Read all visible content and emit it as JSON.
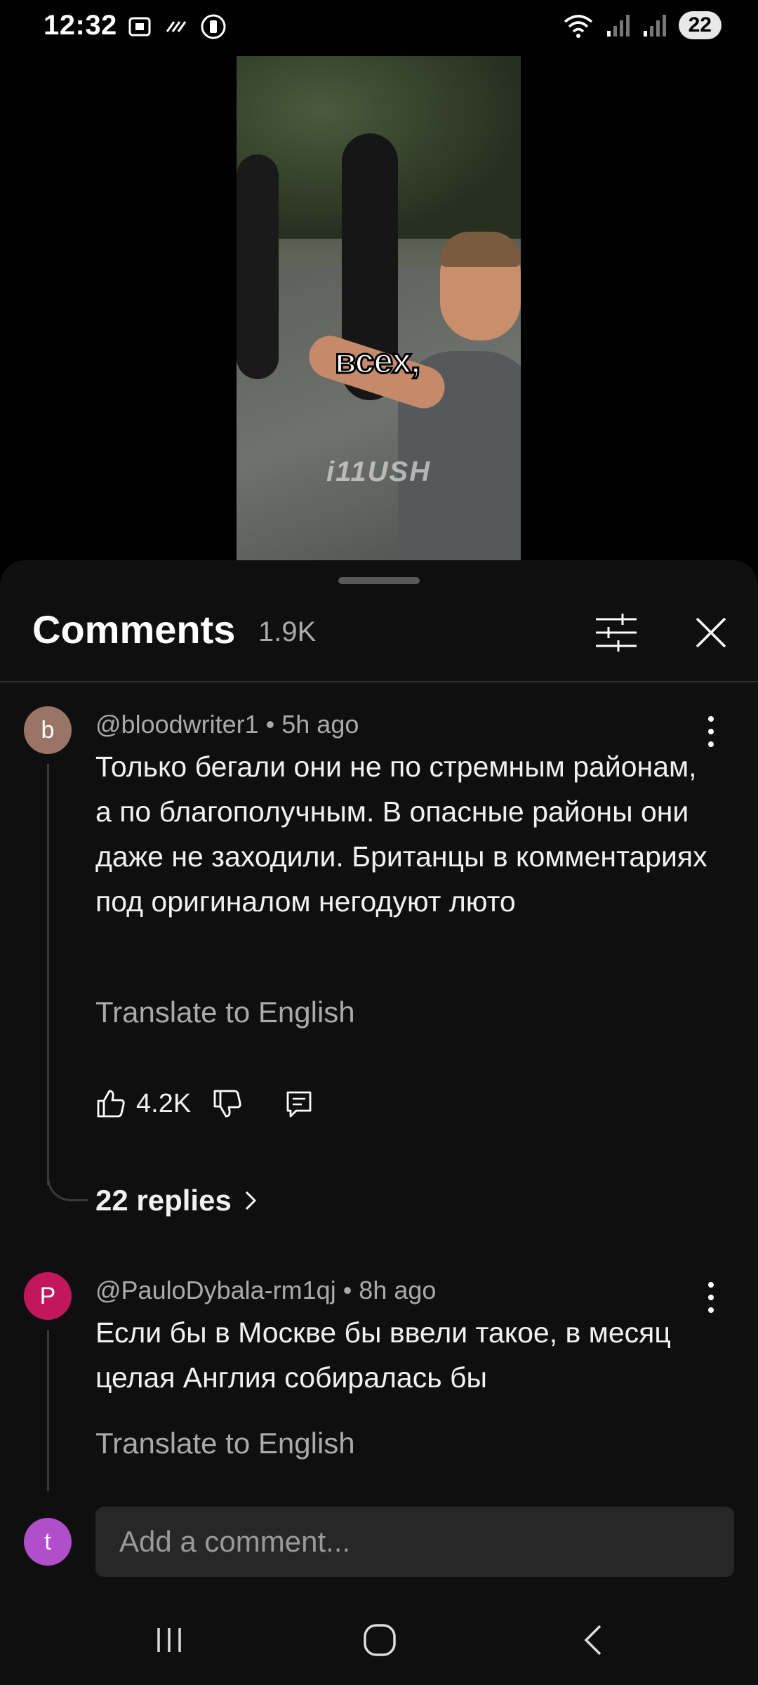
{
  "status_bar": {
    "time": "12:32",
    "battery": "22",
    "icons_left": [
      "screenshot-icon",
      "data-saver-icon",
      "nfc-icon"
    ],
    "icons_right": [
      "wifi-icon",
      "signal-icon",
      "signal-icon"
    ]
  },
  "video": {
    "caption": "всех,",
    "watermark": "i11USH"
  },
  "comments_panel": {
    "title": "Comments",
    "count": "1.9K",
    "icons": [
      "filter-icon",
      "close-icon"
    ]
  },
  "comments": [
    {
      "avatar_letter": "b",
      "avatar_color": "#9b7468",
      "author": "@bloodwriter1",
      "time": "5h ago",
      "meta": "@bloodwriter1 • 5h ago",
      "text": "Только бегали они не по стремным районам, а по благополучным. В опасные районы они даже не заходили. Британцы в комментариях под оригиналом негодуют люто",
      "translate": "Translate to English",
      "likes": "4.2K",
      "replies": "22 replies"
    },
    {
      "avatar_letter": "P",
      "avatar_color": "#c2185b",
      "author": "@PauloDybala-rm1qj",
      "time": "8h ago",
      "meta": "@PauloDybala-rm1qj • 8h ago",
      "text": "Если бы в Москве бы ввели такое, в месяц целая Англия собиралась бы",
      "translate": "Translate to English"
    }
  ],
  "add_comment": {
    "avatar_letter": "t",
    "avatar_color": "#b04fc9",
    "placeholder": "Add a comment..."
  },
  "nav_bar": {
    "buttons": [
      "recents-icon",
      "home-icon",
      "back-icon"
    ]
  }
}
